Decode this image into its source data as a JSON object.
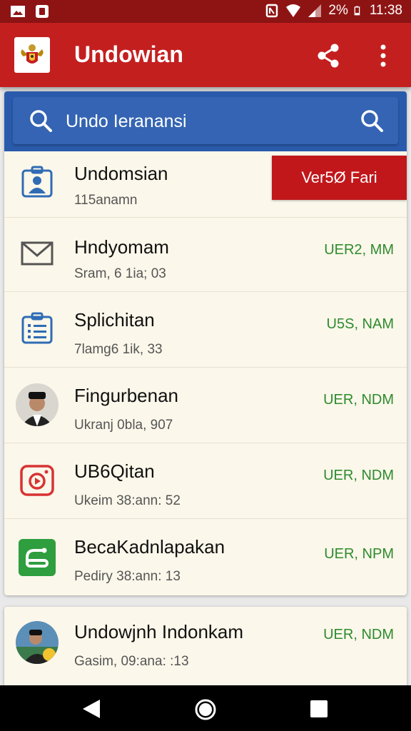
{
  "status_bar": {
    "battery": "2%",
    "time": "11:38",
    "icons": [
      "image-icon",
      "app-icon",
      "nfc-icon",
      "wifi-icon",
      "signal-icon",
      "battery-icon"
    ]
  },
  "app_bar": {
    "title": "Undowian",
    "logo": "garuda-emblem-icon",
    "actions": [
      "share-icon",
      "more-vert-icon"
    ]
  },
  "search": {
    "text": "Undo Ieranansi"
  },
  "list": [
    {
      "title": "Undomsian",
      "subtitle": "115anamn",
      "icon": "contact-id-icon",
      "action_label": "Ver5Ø Fari",
      "status": ""
    },
    {
      "title": "Hndyomam",
      "subtitle": "Sram, 6 1ia; 03",
      "icon": "mail-icon",
      "status": "UER2, MM"
    },
    {
      "title": "Splichitan",
      "subtitle": "7lamg6 1ik, 33",
      "icon": "clipboard-list-icon",
      "status": "U5S, NAM"
    },
    {
      "title": "Fingurbenan",
      "subtitle": "Ukranj 0bla, 907",
      "icon": "avatar-icon",
      "status": "UER, NDM"
    },
    {
      "title": "UB6Qitan",
      "subtitle": "Ukeim 38:ann: 52",
      "icon": "camera-app-icon",
      "status": "UER, NDM"
    },
    {
      "title": "BecaKadnlapakan",
      "subtitle": "Pediry 38:ann: 13",
      "icon": "green-app-icon",
      "status": "UER, NPM"
    }
  ],
  "list2": [
    {
      "title": "Undowjnh Indonkam",
      "subtitle": "Gasim, 09:ana: :13",
      "icon": "avatar-icon",
      "status": "UER, NDM"
    }
  ],
  "colors": {
    "primary": "#c41f1f",
    "status_bar": "#8e1414",
    "search": "#2a5aab",
    "status_green": "#2e8b2e",
    "card_bg": "#fbf7ea"
  }
}
